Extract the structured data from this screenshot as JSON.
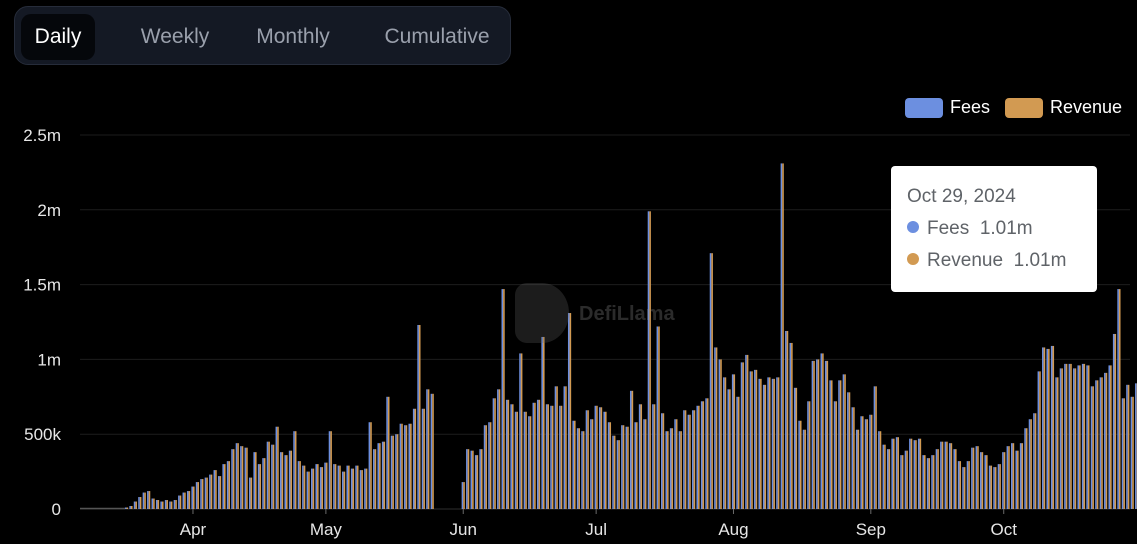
{
  "tabs": [
    {
      "label": "Daily",
      "active": true
    },
    {
      "label": "Weekly",
      "active": false
    },
    {
      "label": "Monthly",
      "active": false
    },
    {
      "label": "Cumulative",
      "active": false
    }
  ],
  "legend": [
    {
      "name": "Fees",
      "color": "#6c8fe0"
    },
    {
      "name": "Revenue",
      "color": "#d29a52"
    }
  ],
  "tooltip": {
    "date": "Oct 29, 2024",
    "rows": [
      {
        "name": "Fees",
        "value": "1.01m",
        "color": "#6c8fe0"
      },
      {
        "name": "Revenue",
        "value": "1.01m",
        "color": "#d29a52"
      }
    ]
  },
  "watermark": "DefiLlama",
  "chart_data": {
    "type": "bar",
    "x_start": "2024-03-07",
    "x_end": "2024-10-29",
    "ylim": [
      0,
      2500000
    ],
    "yticks": [
      {
        "value": 0,
        "label": "0"
      },
      {
        "value": 500000,
        "label": "500k"
      },
      {
        "value": 1000000,
        "label": "1m"
      },
      {
        "value": 1500000,
        "label": "1.5m"
      },
      {
        "value": 2000000,
        "label": "2m"
      },
      {
        "value": 2500000,
        "label": "2.5m"
      }
    ],
    "xticks": [
      {
        "date": "2024-04-01",
        "label": "Apr"
      },
      {
        "date": "2024-05-01",
        "label": "May"
      },
      {
        "date": "2024-06-01",
        "label": "Jun"
      },
      {
        "date": "2024-07-01",
        "label": "Jul"
      },
      {
        "date": "2024-08-01",
        "label": "Aug"
      },
      {
        "date": "2024-09-01",
        "label": "Sep"
      },
      {
        "date": "2024-10-01",
        "label": "Oct"
      }
    ],
    "grid": true,
    "legend_position": "top-right",
    "series": [
      {
        "name": "Fees",
        "color": "#6c8fe0"
      },
      {
        "name": "Revenue",
        "color": "#d29a52"
      }
    ],
    "values": [
      0,
      0,
      0,
      0,
      0,
      0,
      0,
      0,
      0,
      0,
      10000,
      20000,
      50000,
      80000,
      110000,
      120000,
      70000,
      60000,
      50000,
      60000,
      50000,
      60000,
      90000,
      110000,
      120000,
      150000,
      180000,
      200000,
      210000,
      230000,
      260000,
      220000,
      300000,
      320000,
      400000,
      440000,
      420000,
      410000,
      210000,
      380000,
      300000,
      340000,
      450000,
      430000,
      550000,
      380000,
      360000,
      390000,
      520000,
      320000,
      290000,
      250000,
      270000,
      300000,
      280000,
      310000,
      520000,
      300000,
      290000,
      250000,
      290000,
      270000,
      290000,
      260000,
      270000,
      580000,
      400000,
      440000,
      450000,
      750000,
      490000,
      500000,
      570000,
      560000,
      570000,
      670000,
      1230000,
      670000,
      800000,
      770000,
      0,
      0,
      0,
      0,
      0,
      0,
      180000,
      400000,
      390000,
      360000,
      400000,
      560000,
      580000,
      740000,
      800000,
      1470000,
      730000,
      700000,
      650000,
      1040000,
      650000,
      620000,
      710000,
      730000,
      1150000,
      700000,
      690000,
      820000,
      690000,
      820000,
      1310000,
      590000,
      540000,
      520000,
      660000,
      600000,
      690000,
      680000,
      650000,
      580000,
      490000,
      460000,
      560000,
      550000,
      790000,
      580000,
      700000,
      600000,
      1990000,
      700000,
      1220000,
      640000,
      520000,
      540000,
      600000,
      520000,
      660000,
      630000,
      660000,
      690000,
      720000,
      740000,
      1710000,
      1080000,
      1000000,
      880000,
      800000,
      900000,
      750000,
      980000,
      1030000,
      920000,
      930000,
      870000,
      830000,
      880000,
      870000,
      880000,
      2310000,
      1190000,
      1110000,
      810000,
      590000,
      530000,
      720000,
      990000,
      1000000,
      1040000,
      990000,
      860000,
      720000,
      860000,
      900000,
      780000,
      680000,
      530000,
      620000,
      600000,
      630000,
      820000,
      520000,
      430000,
      400000,
      470000,
      480000,
      360000,
      390000,
      470000,
      460000,
      470000,
      360000,
      340000,
      360000,
      400000,
      450000,
      450000,
      440000,
      400000,
      320000,
      280000,
      320000,
      410000,
      420000,
      380000,
      360000,
      290000,
      280000,
      300000,
      380000,
      420000,
      440000,
      390000,
      440000,
      540000,
      600000,
      640000,
      920000,
      1080000,
      1070000,
      1090000,
      880000,
      940000,
      970000,
      970000,
      940000,
      960000,
      970000,
      960000,
      820000,
      860000,
      880000,
      910000,
      960000,
      1170000,
      1470000,
      740000,
      830000,
      750000,
      840000,
      1010000,
      880000,
      1000000,
      1110000,
      1110000,
      1180000,
      1000000,
      860000,
      760000,
      920000,
      1010000
    ]
  }
}
